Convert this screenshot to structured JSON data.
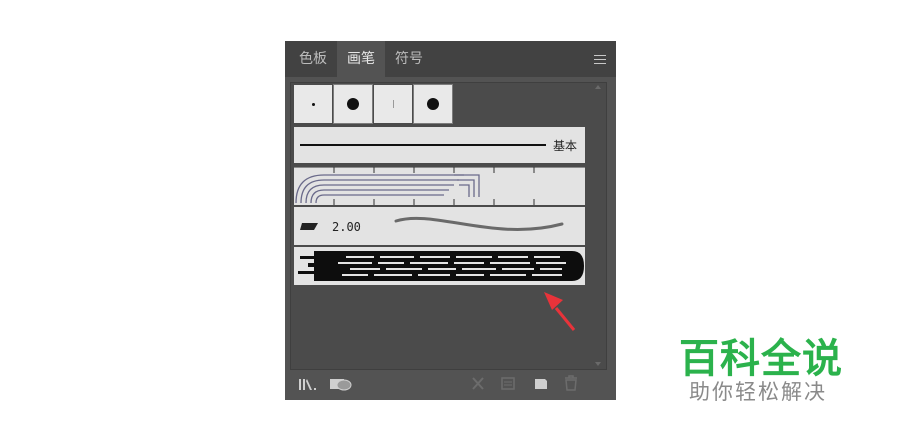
{
  "panel": {
    "tabs": [
      {
        "label": "色板",
        "active": false
      },
      {
        "label": "画笔",
        "active": true
      },
      {
        "label": "符号",
        "active": false
      }
    ],
    "menu_icon": "hamburger-icon"
  },
  "brushes": {
    "calligraphic_presets": [
      "small-dot",
      "large-dot",
      "thin-line",
      "large-dot"
    ],
    "basic_label": "基本",
    "bristle_size": "2.00"
  },
  "footer": {
    "icons": [
      "brush-library-icon",
      "brush-library-menu-icon",
      "remove-stroke-icon",
      "brush-options-icon",
      "new-brush-icon",
      "delete-brush-icon"
    ]
  },
  "watermark": {
    "title": "百科全说",
    "subtitle": "助你轻松解决"
  },
  "colors": {
    "panel_bg": "#535353",
    "tabbar_bg": "#424242",
    "brand_green": "#2bb24c",
    "arrow_red": "#e8333a"
  }
}
